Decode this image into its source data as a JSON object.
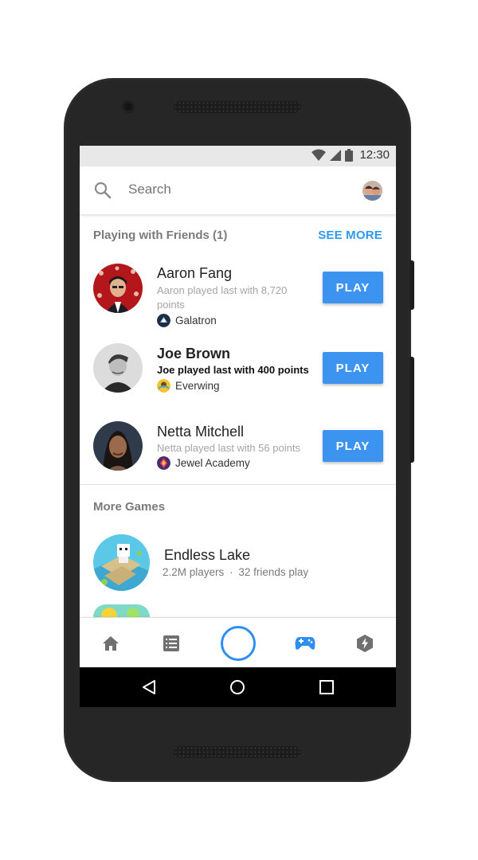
{
  "status_bar": {
    "time": "12:30"
  },
  "search": {
    "placeholder": "Search"
  },
  "friends_section": {
    "title": "Playing with Friends (1)",
    "see_more": "SEE MORE",
    "items": [
      {
        "name": "Aaron Fang",
        "detail": "Aaron played last with 8,720 points",
        "game": "Galatron",
        "play": "PLAY"
      },
      {
        "name": "Joe Brown",
        "detail": "Joe played last with 400 points",
        "game": "Everwing",
        "play": "PLAY"
      },
      {
        "name": "Netta Mitchell",
        "detail": "Netta played last with 56 points",
        "game": "Jewel Academy",
        "play": "PLAY"
      }
    ]
  },
  "more_games": {
    "title": "More Games",
    "items": [
      {
        "name": "Endless Lake",
        "players": "2.2M players",
        "separator": "·",
        "friends": "32 friends play"
      }
    ]
  },
  "bottom_nav": {
    "items": [
      "home-icon",
      "list-icon",
      "camera-icon",
      "games-icon",
      "discover-icon"
    ],
    "active": "games-icon",
    "accent_color": "#2f8ff0"
  },
  "colors": {
    "play_button": "#3d94f0",
    "see_more": "#2d9af0"
  }
}
